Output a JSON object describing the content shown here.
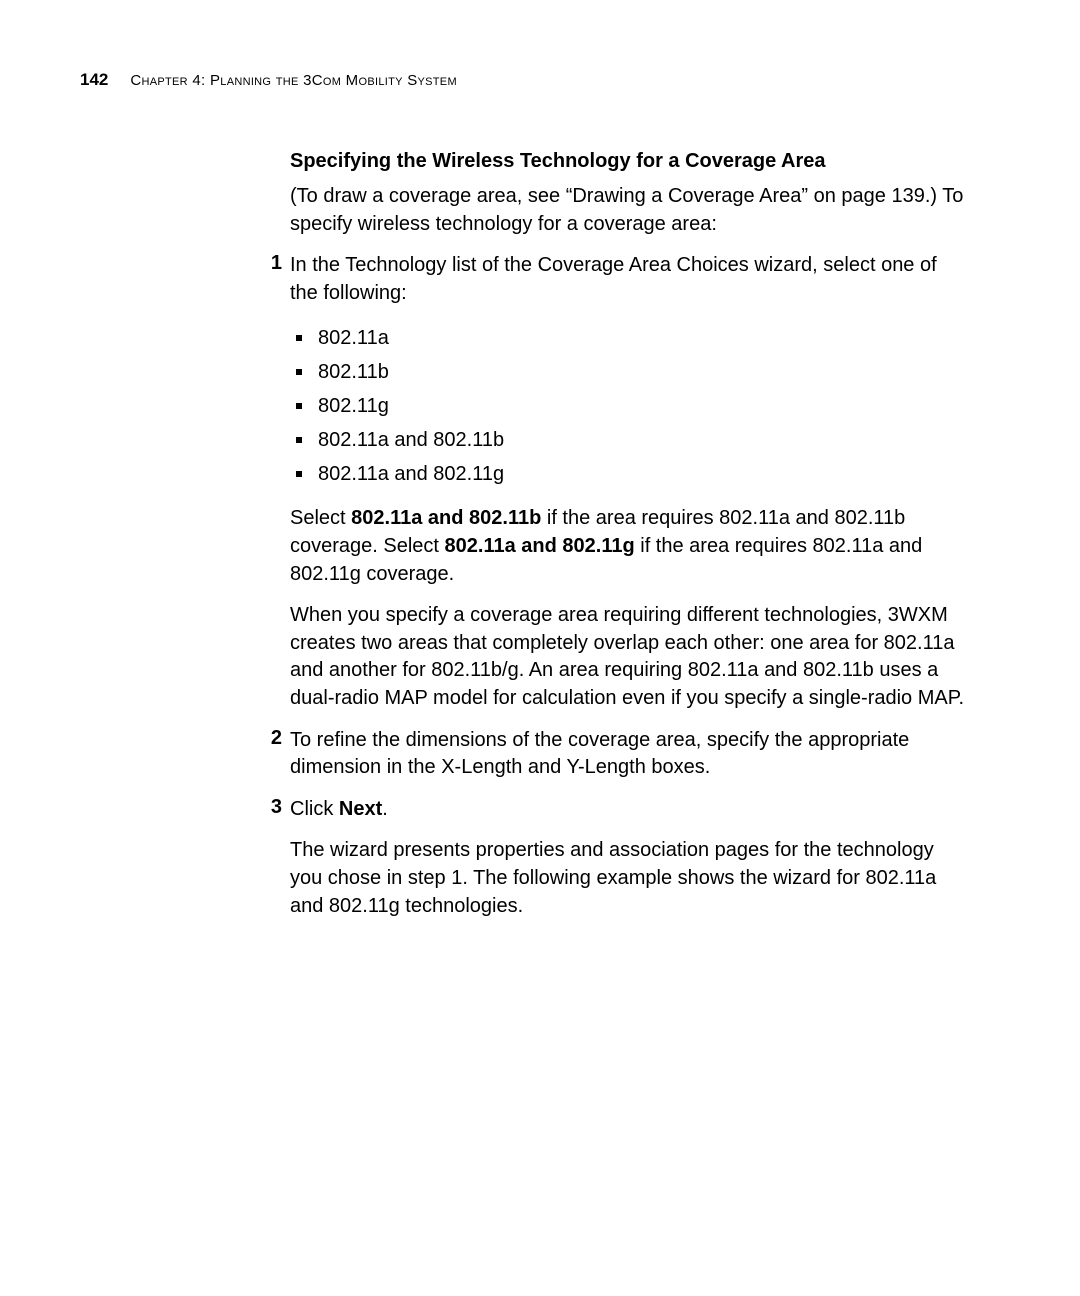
{
  "header": {
    "page_number": "142",
    "chapter_label": "Chapter 4: Planning the 3Com Mobility System"
  },
  "section": {
    "heading": "Specifying the Wireless Technology for a Coverage Area",
    "intro": "(To draw a coverage area, see “Drawing a Coverage Area” on page 139.) To specify wireless technology for a coverage area:"
  },
  "steps": [
    {
      "num": "1",
      "text": "In the Technology list of the Coverage Area Choices wizard, select one of the following:",
      "bullets": [
        "802.11a",
        "802.11b",
        "802.11g",
        "802.11a and 802.11b",
        "802.11a and 802.11g"
      ],
      "after_paras": [
        {
          "segments": [
            {
              "t": "Select "
            },
            {
              "t": "802.11a and 802.11b",
              "b": true
            },
            {
              "t": " if the area requires 802.11a and 802.11b coverage. Select "
            },
            {
              "t": "802.11a and 802.11g",
              "b": true
            },
            {
              "t": " if the area requires 802.11a and 802.11g coverage."
            }
          ]
        },
        {
          "segments": [
            {
              "t": "When you specify a coverage area requiring different technologies, 3WXM creates two areas that completely overlap each other: one area for 802.11a and another for 802.11b/g. An area requiring 802.11a and 802.11b uses a dual-radio MAP model for calculation even if you specify a single-radio MAP."
            }
          ]
        }
      ]
    },
    {
      "num": "2",
      "text": "To refine the dimensions of the coverage area, specify the appropriate dimension in the X-Length and Y-Length boxes."
    },
    {
      "num": "3",
      "segments": [
        {
          "t": "Click "
        },
        {
          "t": "Next",
          "b": true
        },
        {
          "t": "."
        }
      ],
      "after_paras": [
        {
          "segments": [
            {
              "t": "The wizard presents properties and association pages for the technology you chose in step 1. The following example shows the wizard for 802.11a and 802.11g technologies."
            }
          ]
        }
      ]
    }
  ]
}
